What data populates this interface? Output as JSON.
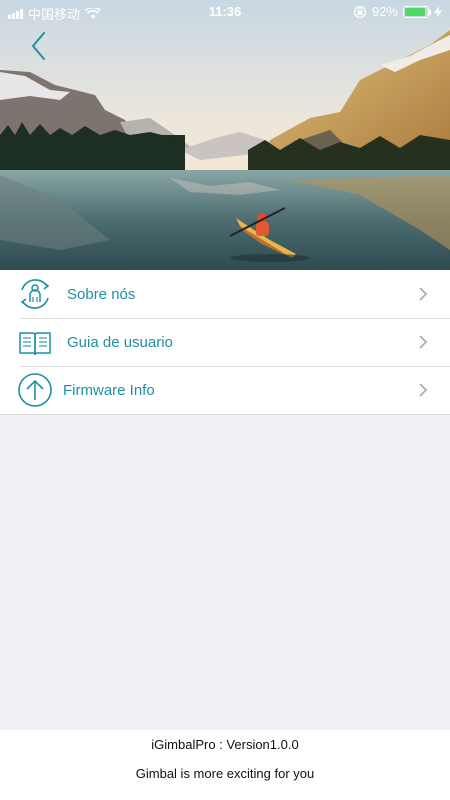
{
  "status_bar": {
    "carrier": "中国移动",
    "time": "11:36",
    "battery_percent": "92%",
    "battery_level": 0.92,
    "icons": [
      "signal-icon",
      "wifi-icon",
      "orientation-lock-icon",
      "battery-icon",
      "charging-icon"
    ]
  },
  "header": {
    "back_icon": "chevron-left-icon"
  },
  "menu": {
    "items": [
      {
        "label": "Sobre nós",
        "icon": "person-sync-icon"
      },
      {
        "label": "Guia de usuario",
        "icon": "book-icon"
      },
      {
        "label": "Firmware Info",
        "icon": "arrow-up-circle-icon"
      }
    ]
  },
  "footer": {
    "version": "iGimbalPro : Version1.0.0",
    "tagline": "Gimbal is more exciting for you"
  },
  "colors": {
    "accent": "#1f8fa6",
    "background": "#efeff4",
    "battery": "#4cd964"
  }
}
